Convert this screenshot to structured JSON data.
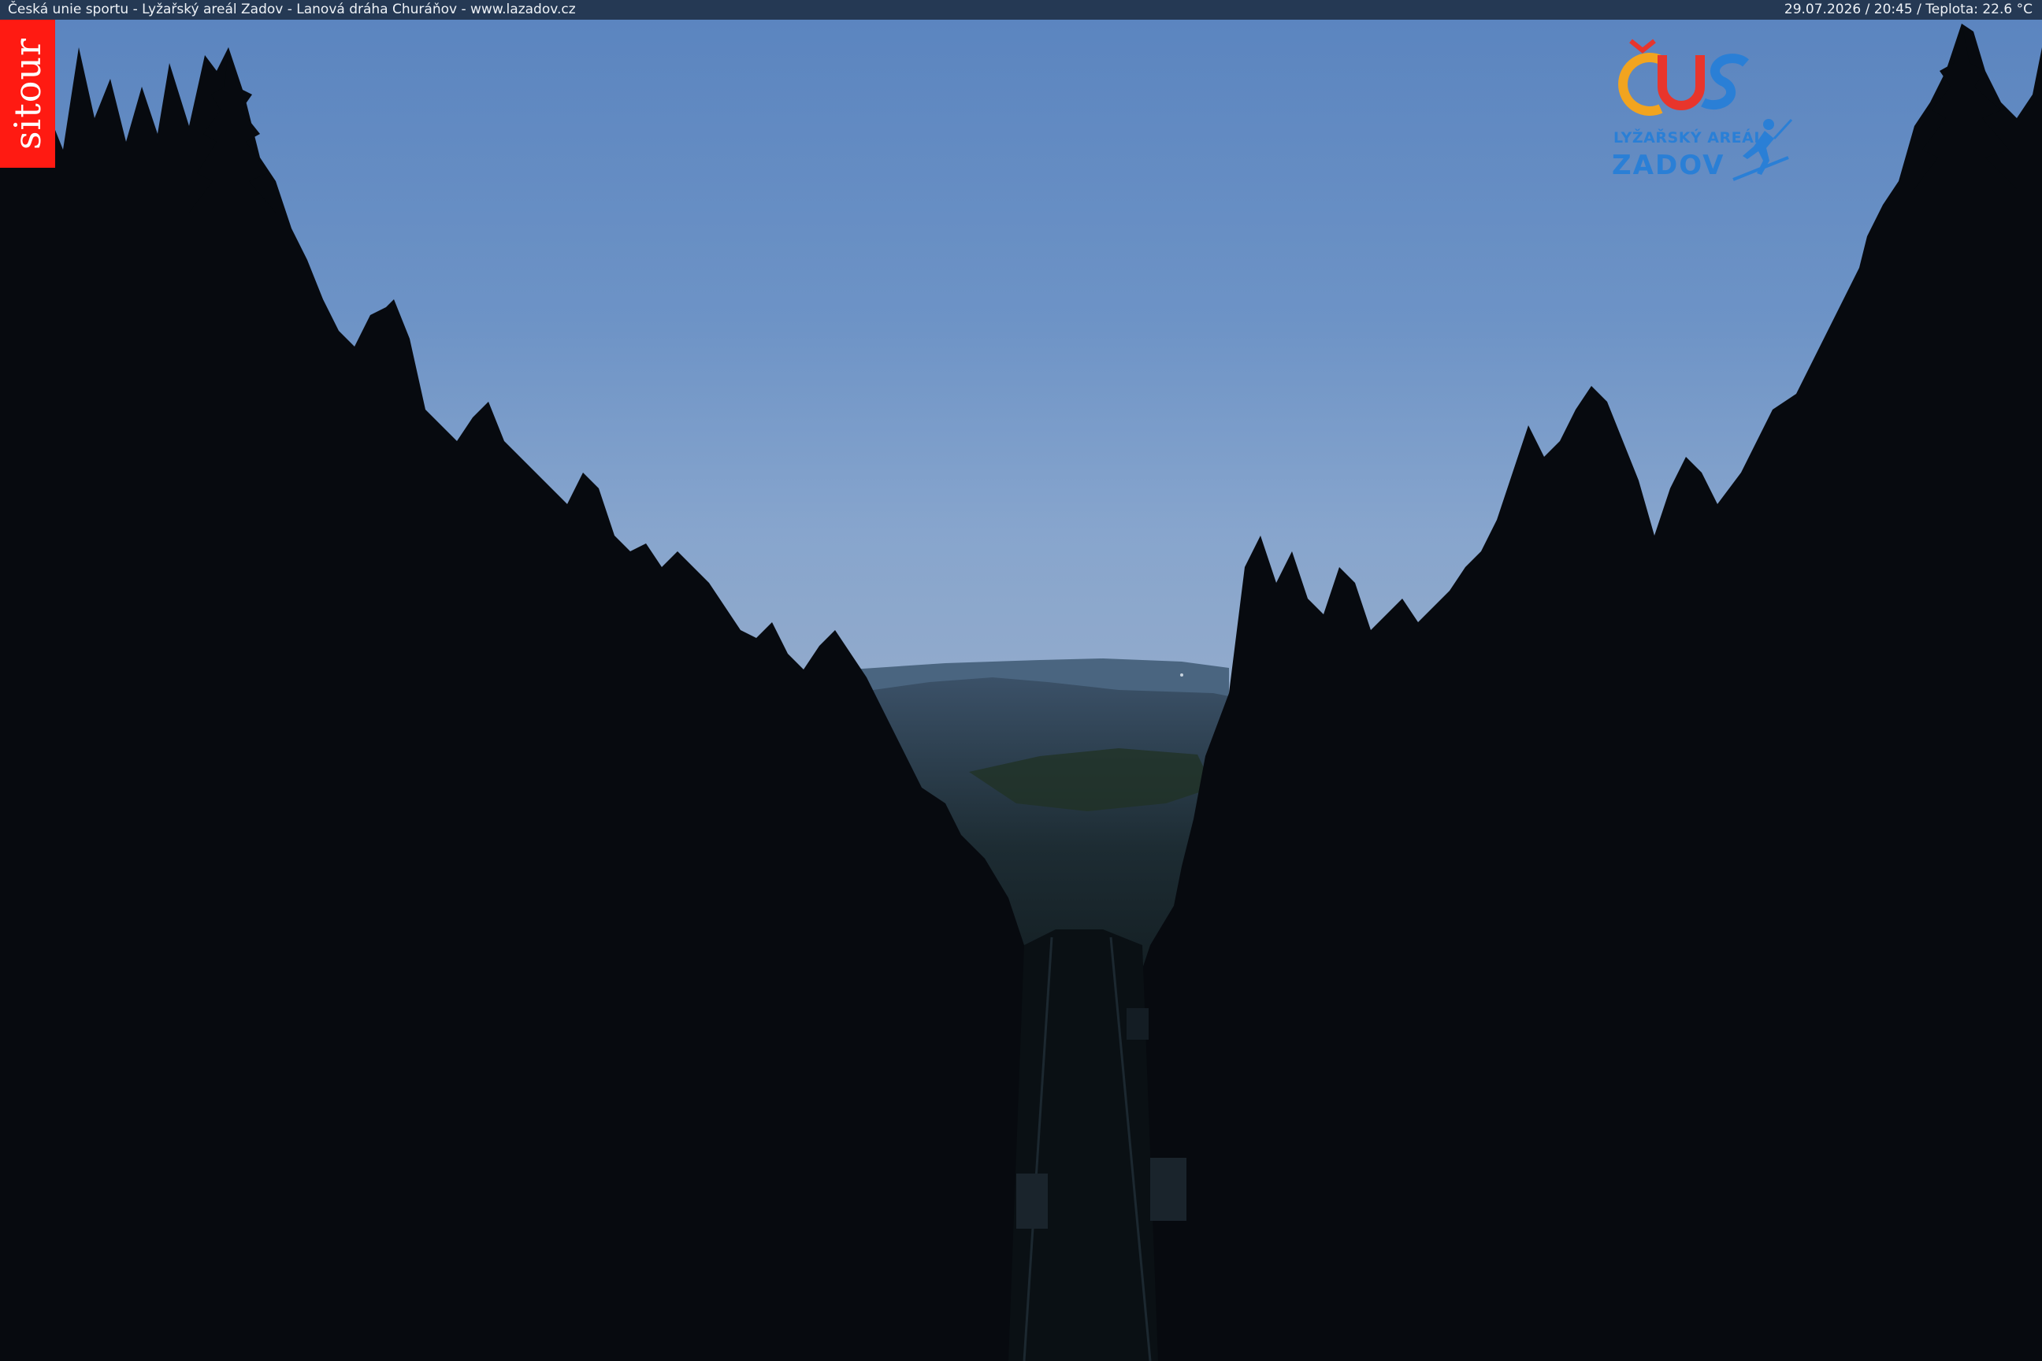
{
  "overlay": {
    "title_text": "Česká unie sportu - Lyžařský areál Zadov - Lanová dráha Churáňov - www.lazadov.cz",
    "status_text": "29.07.2026 / 20:45 / Teplota: 22.6 °C"
  },
  "branding": {
    "sitour_label": "sitour",
    "sitour_color": "#ff1a12",
    "logo_mark": "ČUS",
    "logo_line1": "LYŽAŘSKÝ AREÁL",
    "logo_line2": "ZADOV",
    "logo_color": "#2a7fd6"
  },
  "colors": {
    "sky_top": "#5b86c0",
    "sky_horizon": "#8aa9cf",
    "forest": "#06090d"
  }
}
